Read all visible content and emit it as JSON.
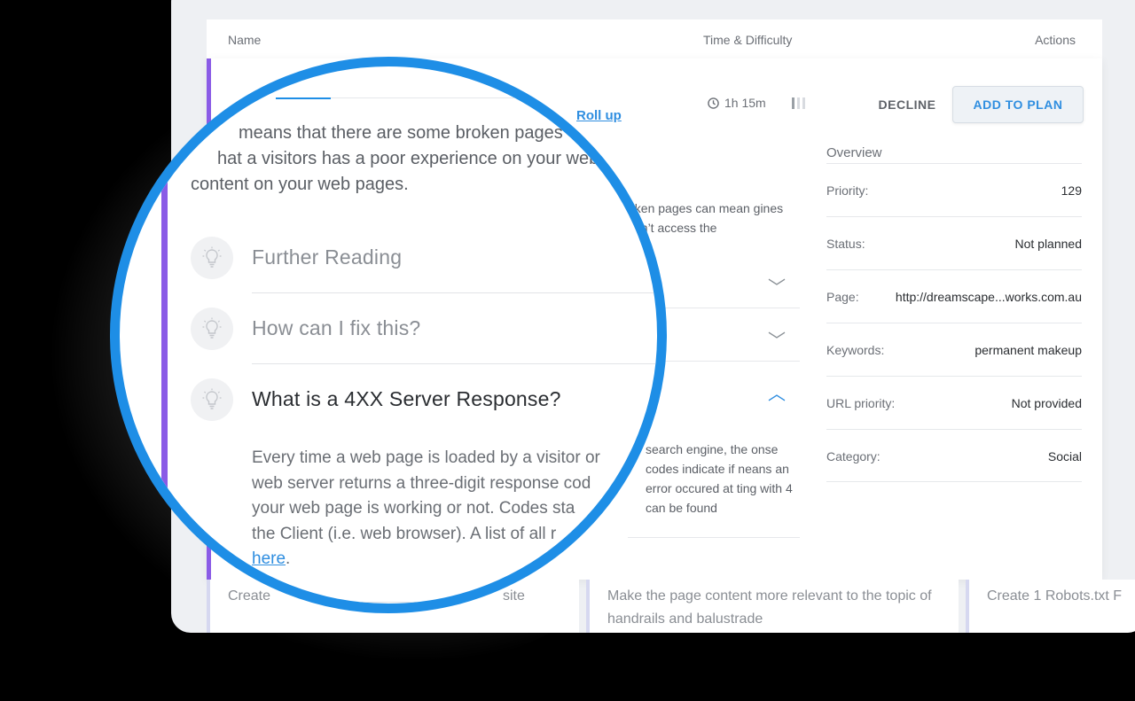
{
  "table": {
    "col_name": "Name",
    "col_time": "Time & Difficulty",
    "col_actions": "Actions"
  },
  "task": {
    "rollup": "Roll up",
    "time": "1h 15m",
    "difficulty_level": 1,
    "difficulty_max": 3,
    "decline": "DECLINE",
    "add_to_plan": "ADD TO PLAN",
    "description_partial": "means that there are some broken pages at a visitors has a poor experience on your web content on your web pages.",
    "desc_line1": "means that there are some broken pages",
    "desc_line1_tail": "e",
    "desc_line2": "hat a visitors has a poor experience on your web",
    "desc_line3": "content on your web pages.",
    "behind_text": "oken pages can mean gines can’t access the",
    "behind_answer": "search engine, the onse codes indicate if neans an error occured at ting with 4 can be found"
  },
  "accordion": [
    {
      "label": "Further Reading",
      "expanded": false
    },
    {
      "label": "How can I fix this?",
      "expanded": false
    },
    {
      "label": "What is a 4XX Server Response?",
      "expanded": true
    }
  ],
  "answer": {
    "text": "Every time a web page is loaded by a visitor or a search engine, the web server returns a three-digit response code. Response codes indicate if your web page is working or not. Codes starting with 4 means an error occured at the Client (i.e. web browser). A list of all response codes starting with 4 can be found",
    "visible_line1": "Every time a web page is loaded by a visitor or",
    "visible_line2": "web server returns a three-digit response cod",
    "visible_line3": "your web page is working or not. Codes sta",
    "visible_line4": "the Client (i.e. web browser). A list of all r",
    "link": "here",
    "end": "."
  },
  "overview": {
    "title": "Overview",
    "rows": [
      {
        "key": "Priority:",
        "value": "129"
      },
      {
        "key": "Status:",
        "value": "Not planned"
      },
      {
        "key": "Page:",
        "value": "http://dreamscape...works.com.au"
      },
      {
        "key": "Keywords:",
        "value": "permanent makeup"
      },
      {
        "key": "URL priority:",
        "value": "Not provided"
      },
      {
        "key": "Category:",
        "value": "Social"
      }
    ]
  },
  "bottom_cards": [
    {
      "text": "Create",
      "text2": "site"
    },
    {
      "text": "Make the page content more relevant to the topic of handrails and balustrade"
    },
    {
      "text": "Create 1 Robots.txt F"
    }
  ],
  "colors": {
    "accent_blue": "#1e8ee6",
    "accent_purple": "#8a5be6",
    "link_blue": "#2f8ee0"
  }
}
